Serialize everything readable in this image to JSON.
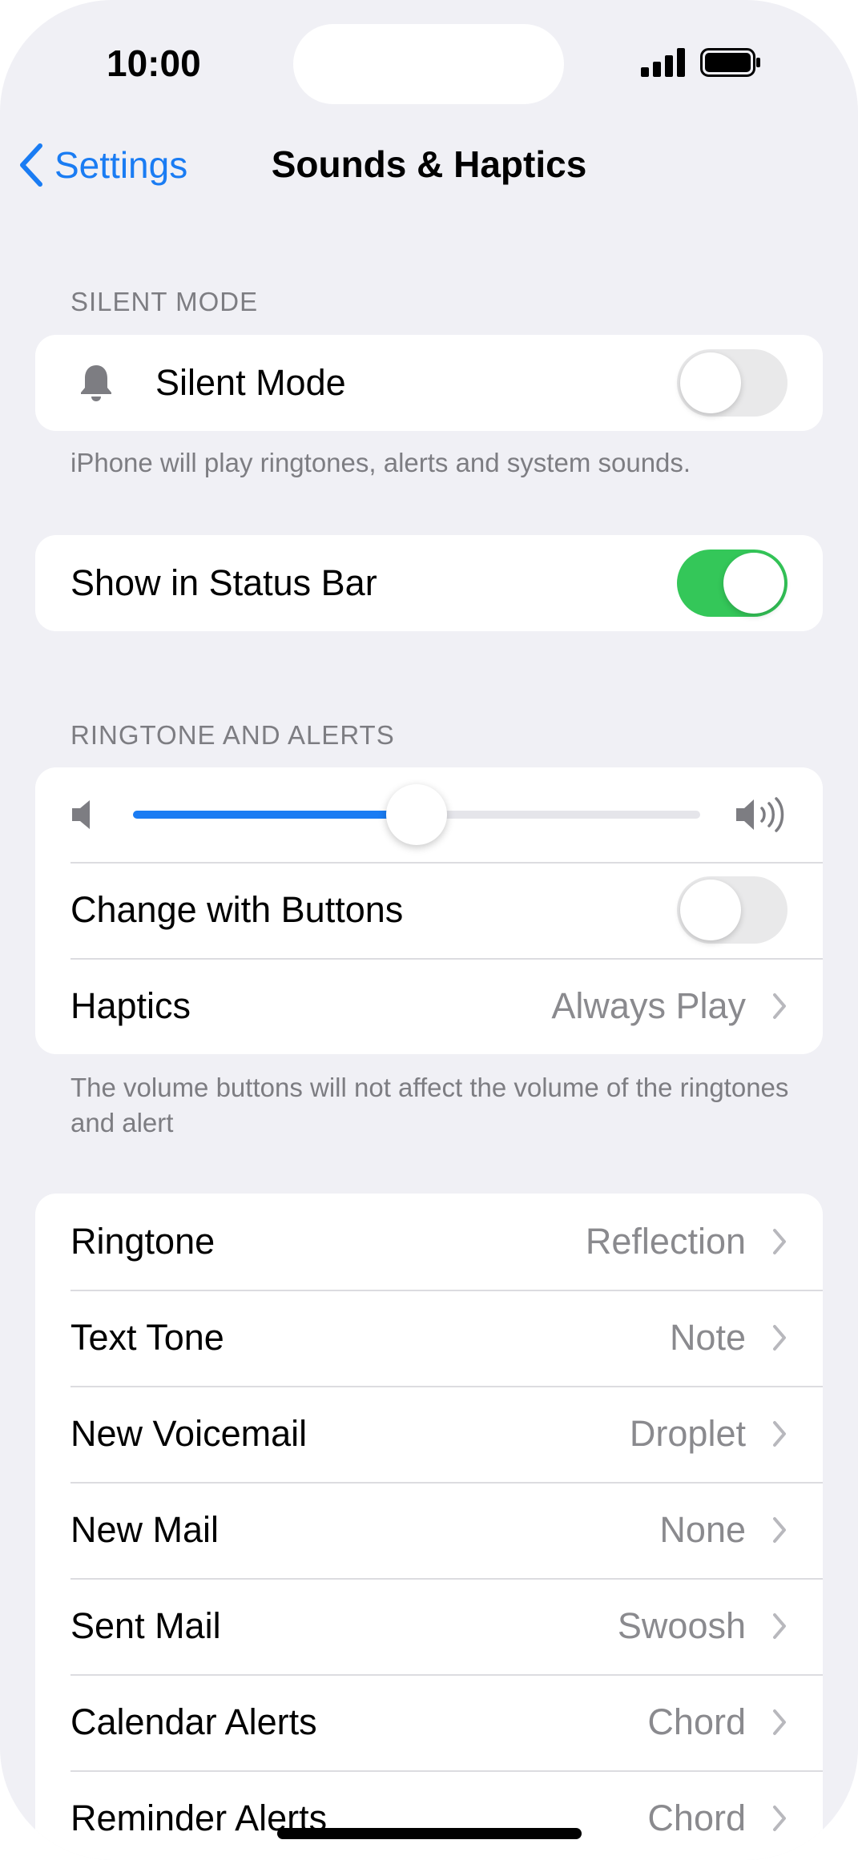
{
  "status_bar": {
    "time": "10:00"
  },
  "nav": {
    "back_label": "Settings",
    "title": "Sounds & Haptics"
  },
  "silent_mode_section": {
    "header": "SILENT MODE",
    "silent_mode_label": "Silent Mode",
    "silent_mode_on": false,
    "note": "iPhone will play ringtones, alerts and system sounds."
  },
  "status_bar_section": {
    "show_in_status_bar_label": "Show in Status Bar",
    "show_in_status_bar_on": true
  },
  "ringtone_section": {
    "header": "RINGTONE AND ALERTS",
    "volume_level": 0.5,
    "change_with_buttons_label": "Change with Buttons",
    "change_with_buttons_on": false,
    "haptics_label": "Haptics",
    "haptics_value": "Always Play",
    "note": "The volume buttons will not affect the volume of the ringtones and alert"
  },
  "sounds": [
    {
      "label": "Ringtone",
      "value": "Reflection"
    },
    {
      "label": "Text Tone",
      "value": "Note"
    },
    {
      "label": "New Voicemail",
      "value": "Droplet"
    },
    {
      "label": "New Mail",
      "value": "None"
    },
    {
      "label": "Sent Mail",
      "value": "Swoosh"
    },
    {
      "label": "Calendar Alerts",
      "value": "Chord"
    },
    {
      "label": "Reminder Alerts",
      "value": "Chord"
    }
  ],
  "colors": {
    "accent": "#1a7cf3",
    "toggle_on": "#34c759",
    "toggle_off": "#e9e9ea",
    "background": "#f0f0f5"
  }
}
